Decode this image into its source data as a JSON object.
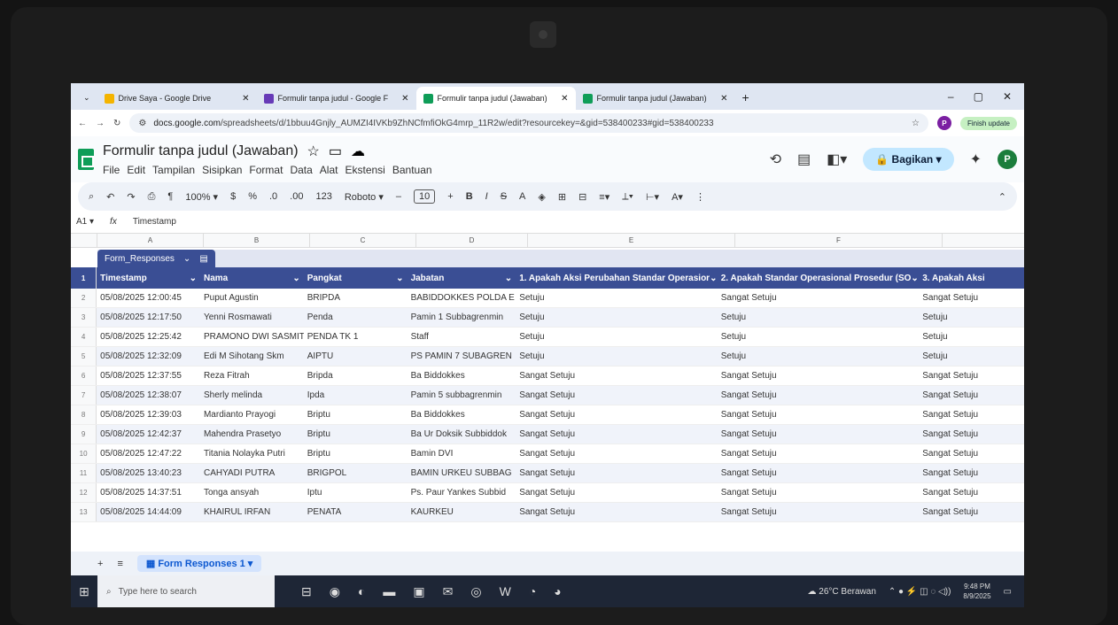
{
  "browser": {
    "tabs": [
      {
        "label": "Drive Saya - Google Drive",
        "color": "#f4b400"
      },
      {
        "label": "Formulir tanpa judul - Google F",
        "color": "#673ab7"
      },
      {
        "label": "Formulir tanpa judul (Jawaban)",
        "color": "#0f9d58"
      },
      {
        "label": "Formulir tanpa judul (Jawaban)",
        "color": "#0f9d58"
      }
    ],
    "url_host": "docs.google.com",
    "url_path": "/spreadsheets/d/1bbuu4Gnjly_AUMZI4IVKb9ZhNCfmfiOkG4mrp_11R2w/edit?resourcekey=&gid=538400233#gid=538400233",
    "profile_initial": "P",
    "finish_update": "Finish update"
  },
  "app": {
    "title": "Formulir tanpa judul (Jawaban)",
    "menus": [
      "File",
      "Edit",
      "Tampilan",
      "Sisipkan",
      "Format",
      "Data",
      "Alat",
      "Ekstensi",
      "Bantuan"
    ],
    "share_label": "Bagikan",
    "avatar": "P"
  },
  "toolbar": {
    "zoom": "100%",
    "currency": "$",
    "percent": "%",
    "dec_less": ".0",
    "dec_more": ".00",
    "num_format": "123",
    "font": "Roboto",
    "font_size": "10"
  },
  "formula_bar": {
    "cell_ref": "A1",
    "content": "Timestamp"
  },
  "grid": {
    "columns": [
      "A",
      "B",
      "C",
      "D",
      "E",
      "F"
    ],
    "table_name": "Form_Responses",
    "headers": [
      "Timestamp",
      "Nama",
      "Pangkat",
      "Jabatan",
      "1. Apakah Aksi Perubahan Standar Operasior",
      "2. Apakah Standar Operasional Prosedur (SO",
      "3. Apakah Aksi"
    ],
    "rows": [
      {
        "n": "2",
        "c": [
          "05/08/2025 12:00:45",
          "Puput Agustin",
          "BRIPDA",
          "BABIDDOKKES POLDA E",
          "Setuju",
          "Sangat Setuju",
          "Sangat Setuju"
        ]
      },
      {
        "n": "3",
        "c": [
          "05/08/2025 12:17:50",
          "Yenni Rosmawati",
          "Penda",
          "Pamin 1 Subbagrenmin",
          "Setuju",
          "Setuju",
          "Setuju"
        ]
      },
      {
        "n": "4",
        "c": [
          "05/08/2025 12:25:42",
          "PRAMONO DWI SASMIT",
          "PENDA TK 1",
          "Staff",
          "Setuju",
          "Setuju",
          "Setuju"
        ]
      },
      {
        "n": "5",
        "c": [
          "05/08/2025 12:32:09",
          "Edi M Sihotang Skm",
          "AIPTU",
          "PS PAMIN 7 SUBAGREN",
          "Setuju",
          "Setuju",
          "Setuju"
        ]
      },
      {
        "n": "6",
        "c": [
          "05/08/2025 12:37:55",
          "Reza Fitrah",
          "Bripda",
          "Ba Biddokkes",
          "Sangat Setuju",
          "Sangat Setuju",
          "Sangat Setuju"
        ]
      },
      {
        "n": "7",
        "c": [
          "05/08/2025 12:38:07",
          "Sherly melinda",
          "Ipda",
          "Pamin 5 subbagrenmin",
          "Sangat Setuju",
          "Sangat Setuju",
          "Sangat Setuju"
        ]
      },
      {
        "n": "8",
        "c": [
          "05/08/2025 12:39:03",
          "Mardianto Prayogi",
          "Briptu",
          "Ba Biddokkes",
          "Sangat Setuju",
          "Sangat Setuju",
          "Sangat Setuju"
        ]
      },
      {
        "n": "9",
        "c": [
          "05/08/2025 12:42:37",
          "Mahendra Prasetyo",
          "Briptu",
          "Ba Ur Doksik Subbiddok",
          "Sangat Setuju",
          "Sangat Setuju",
          "Sangat Setuju"
        ]
      },
      {
        "n": "10",
        "c": [
          "05/08/2025 12:47:22",
          "Titania Nolayka Putri",
          "Briptu",
          "Bamin DVI",
          "Sangat Setuju",
          "Sangat Setuju",
          "Sangat Setuju"
        ]
      },
      {
        "n": "11",
        "c": [
          "05/08/2025 13:40:23",
          "CAHYADI PUTRA",
          "BRIGPOL",
          "BAMIN URKEU SUBBAG",
          "Sangat Setuju",
          "Sangat Setuju",
          "Sangat Setuju"
        ]
      },
      {
        "n": "12",
        "c": [
          "05/08/2025 14:37:51",
          "Tonga ansyah",
          "Iptu",
          "Ps. Paur Yankes Subbid",
          "Sangat Setuju",
          "Sangat Setuju",
          "Sangat Setuju"
        ]
      },
      {
        "n": "13",
        "c": [
          "05/08/2025 14:44:09",
          "KHAIRUL IRFAN",
          "PENATA",
          "KAURKEU",
          "Sangat Setuju",
          "Sangat Setuju",
          "Sangat Setuju"
        ]
      }
    ]
  },
  "sheet_tab": "Form Responses 1",
  "taskbar": {
    "search_placeholder": "Type here to search",
    "weather": "26°C Berawan",
    "time": "9:48 PM",
    "date": "8/9/2025"
  }
}
